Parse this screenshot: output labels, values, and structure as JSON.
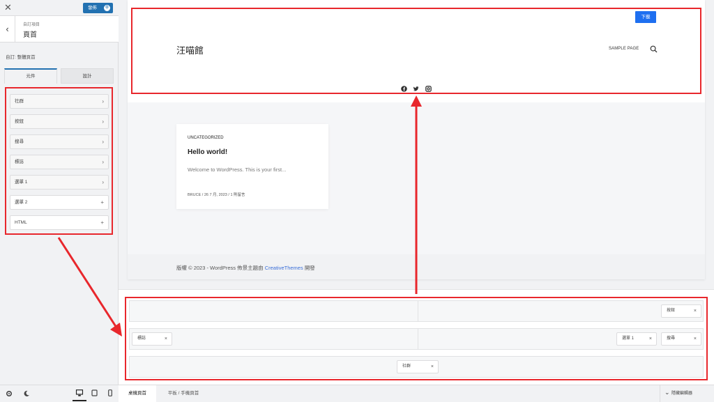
{
  "topbar": {
    "close": "✕",
    "publish_label": "發佈",
    "publish_gear": "⚙"
  },
  "section": {
    "back": "‹",
    "crumb": "自訂項目",
    "title": "頁首"
  },
  "editing_label": "自訂: 整體頁首",
  "tabs": [
    {
      "label": "元件"
    },
    {
      "label": "設計"
    }
  ],
  "elements": [
    {
      "label": "社群",
      "icon": "›"
    },
    {
      "label": "按鈕",
      "icon": "›"
    },
    {
      "label": "搜尋",
      "icon": "›"
    },
    {
      "label": "標誌",
      "icon": "›"
    },
    {
      "label": "選單 1",
      "icon": "›"
    },
    {
      "label": "選單 2",
      "icon": "+"
    },
    {
      "label": "HTML",
      "icon": "+"
    }
  ],
  "preview": {
    "download_btn": "下載",
    "site_title": "汪喵館",
    "nav_item": "SAMPLE PAGE",
    "post": {
      "category": "UNCATEGORIZED",
      "title": "Hello world!",
      "excerpt": "Welcome to WordPress. This is your first...",
      "meta": "BRUCE / 26 7 月, 2023 / 1 則留言"
    },
    "footer_text": "版權 © 2023 - WordPress 佈景主題由",
    "footer_link": "CreativeThemes",
    "footer_suffix": "開發"
  },
  "builder": {
    "top_right": {
      "label": "按鈕",
      "x": "×"
    },
    "mid_left": {
      "label": "標誌",
      "x": "×"
    },
    "mid_right_1": {
      "label": "選單 1",
      "x": "×"
    },
    "mid_right_2": {
      "label": "搜尋",
      "x": "×"
    },
    "bottom_center": {
      "label": "社群",
      "x": "×"
    }
  },
  "bottom_bar": {
    "desktop_tab": "桌機頁首",
    "tablet_tab": "平板 / 手機頁首",
    "hide_builder": "隱藏編輯器",
    "hide_icon": "⌄"
  },
  "colors": {
    "accent": "#2271b1",
    "button": "#1e6ff0",
    "highlight": "#e8272c",
    "link": "#3b6fd8"
  }
}
